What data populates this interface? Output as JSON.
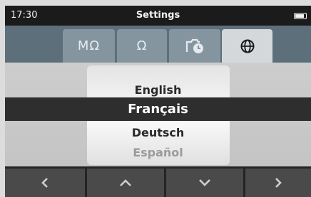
{
  "status": {
    "time": "17:30",
    "title": "Settings",
    "battery_icon": "battery-icon",
    "battery_level": 0.9
  },
  "tabs": [
    {
      "label": "MΩ",
      "icon": "megaohm",
      "active": false
    },
    {
      "label": "Ω",
      "icon": "ohm",
      "active": false
    },
    {
      "label": "",
      "icon": "timer-card-icon",
      "active": false
    },
    {
      "label": "",
      "icon": "globe-icon",
      "active": true
    }
  ],
  "language_picker": {
    "options": [
      "English",
      "Français",
      "Deutsch",
      "Español"
    ],
    "selected": "Français"
  },
  "nav": {
    "buttons": [
      "chevron-left-icon",
      "chevron-up-icon",
      "chevron-down-icon",
      "chevron-right-icon"
    ]
  }
}
